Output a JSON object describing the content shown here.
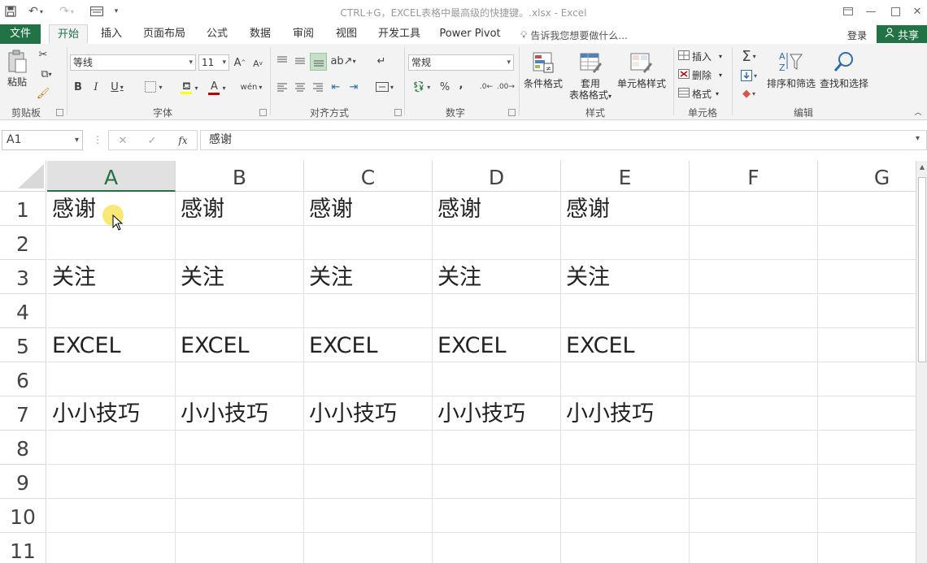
{
  "window": {
    "title": "CTRL+G，EXCEL表格中最高级的快捷键。.xlsx - Excel",
    "controls": [
      "restore-icon",
      "minimize-icon",
      "maximize-icon",
      "close-icon"
    ]
  },
  "quick_access": [
    "save-icon",
    "undo-icon",
    "redo-icon",
    "form-icon",
    "customize-icon"
  ],
  "tabs": [
    {
      "label": "文件",
      "active": false,
      "file": true
    },
    {
      "label": "开始",
      "active": true
    },
    {
      "label": "插入"
    },
    {
      "label": "页面布局"
    },
    {
      "label": "公式"
    },
    {
      "label": "数据"
    },
    {
      "label": "审阅"
    },
    {
      "label": "视图"
    },
    {
      "label": "开发工具"
    },
    {
      "label": "Power Pivot"
    }
  ],
  "tell_me": "告诉我您想要做什么...",
  "login": "登录",
  "share": "共享",
  "ribbon": {
    "clipboard": {
      "paste": "粘贴",
      "label": "剪贴板"
    },
    "font": {
      "name": "等线",
      "size": "11",
      "label": "字体"
    },
    "alignment": {
      "label": "对齐方式"
    },
    "number": {
      "format": "常规",
      "label": "数字",
      "percent": "%",
      "comma": ","
    },
    "styles": {
      "conditional": "条件格式",
      "table_line1": "套用",
      "table_line2": "表格格式",
      "cell_styles": "单元格样式",
      "label": "样式"
    },
    "cells": {
      "insert": "插入",
      "delete": "删除",
      "format": "格式",
      "label": "单元格"
    },
    "editing": {
      "sort": "排序和筛选",
      "find": "查找和选择",
      "label": "编辑"
    }
  },
  "formula_bar": {
    "name_box": "A1",
    "content": "感谢",
    "fx": "fx"
  },
  "columns": [
    "A",
    "B",
    "C",
    "D",
    "E",
    "F",
    "G"
  ],
  "rows": [
    "1",
    "2",
    "3",
    "4",
    "5",
    "6",
    "7",
    "8",
    "9",
    "10",
    "11"
  ],
  "cells": [
    [
      "感谢",
      "感谢",
      "感谢",
      "感谢",
      "感谢",
      "",
      ""
    ],
    [
      "",
      "",
      "",
      "",
      "",
      "",
      ""
    ],
    [
      "关注",
      "关注",
      "关注",
      "关注",
      "关注",
      "",
      ""
    ],
    [
      "",
      "",
      "",
      "",
      "",
      "",
      ""
    ],
    [
      "EXCEL",
      "EXCEL",
      "EXCEL",
      "EXCEL",
      "EXCEL",
      "",
      ""
    ],
    [
      "",
      "",
      "",
      "",
      "",
      "",
      ""
    ],
    [
      "小小技巧",
      "小小技巧",
      "小小技巧",
      "小小技巧",
      "小小技巧",
      "",
      ""
    ],
    [
      "",
      "",
      "",
      "",
      "",
      "",
      ""
    ],
    [
      "",
      "",
      "",
      "",
      "",
      "",
      ""
    ],
    [
      "",
      "",
      "",
      "",
      "",
      "",
      ""
    ],
    [
      "",
      "",
      "",
      "",
      "",
      "",
      ""
    ]
  ],
  "selected_cell": "A1",
  "colors": {
    "accent": "#217346",
    "header_selected": "#e1e1e1",
    "grid": "#e1e1e1",
    "cursor_highlight": "#f5e14a"
  }
}
